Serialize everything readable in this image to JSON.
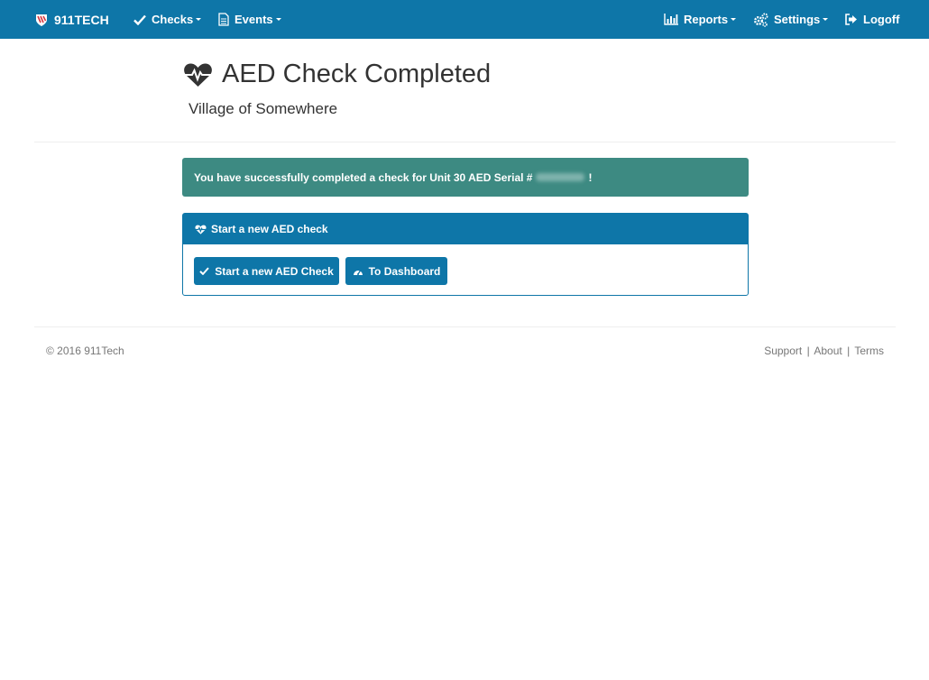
{
  "navbar": {
    "brand": "911TECH",
    "checks": "Checks",
    "events": "Events",
    "reports": "Reports",
    "settings": "Settings",
    "logoff": "Logoff",
    "color": "#0e76a8"
  },
  "header": {
    "title": "AED Check Completed",
    "subtitle": "Village of Somewhere"
  },
  "alert": {
    "text_before": "You have successfully completed a check for Unit 30 AED Serial #",
    "text_after": "!",
    "color": "#3d8a82"
  },
  "panel": {
    "heading": "Start a new AED check",
    "start_button": "Start a new AED Check",
    "dashboard_button": "To Dashboard"
  },
  "footer": {
    "copyright": "© 2016  911Tech",
    "support": "Support",
    "about": "About",
    "terms": "Terms",
    "separator": "|"
  },
  "icons": [
    "shield-flag-icon",
    "check-icon",
    "document-icon",
    "bar-chart-icon",
    "gears-icon",
    "logoff-icon",
    "heartbeat-icon",
    "dashboard-icon"
  ]
}
